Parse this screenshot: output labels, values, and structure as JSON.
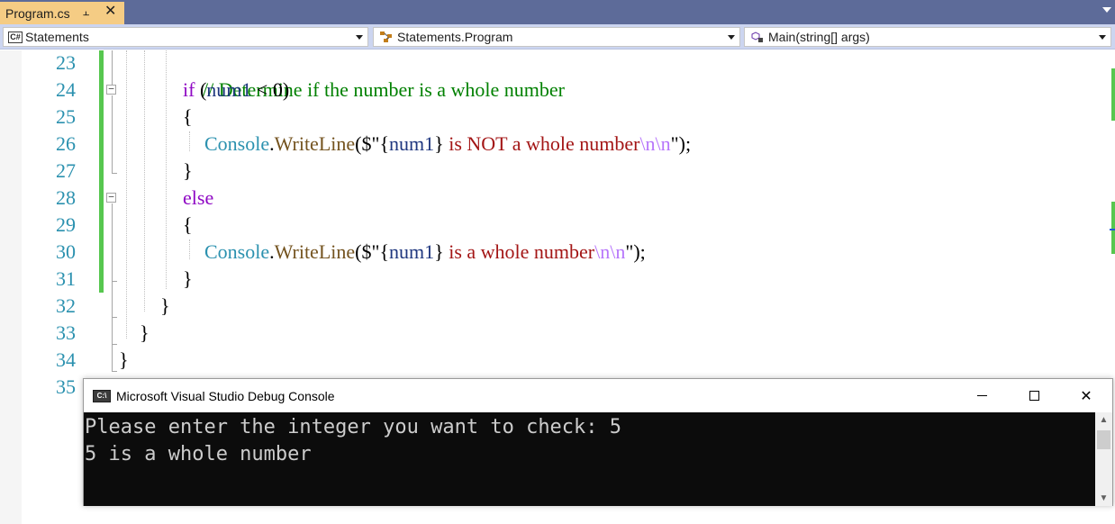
{
  "tab": {
    "label": "Program.cs",
    "pin_icon": "pin-icon",
    "close_icon": "close-icon"
  },
  "navbar": {
    "project": {
      "label": "Statements",
      "icon": "csharp-project-icon"
    },
    "type": {
      "label": "Statements.Program",
      "icon": "class-icon"
    },
    "member": {
      "label": "Main(string[] args)",
      "icon": "method-icon"
    }
  },
  "editor": {
    "line_numbers": [
      "23",
      "24",
      "25",
      "26",
      "27",
      "28",
      "29",
      "30",
      "31",
      "32",
      "33",
      "34",
      "35"
    ],
    "lines": {
      "l23": {
        "comment": "// Determine if the number is a whole number"
      },
      "l24": {
        "kw": "if",
        "rest_open": " (",
        "var": "num1",
        "rest": " < 0)"
      },
      "l25": {
        "text": "{"
      },
      "l26": {
        "cls": "Console",
        "dot": ".",
        "mth": "WriteLine",
        "open": "($\"",
        "brace_open": "{",
        "var": "num1",
        "brace_close": "}",
        "str": " is NOT a whole number",
        "esc": "\\n\\n",
        "close": "\");"
      },
      "l27": {
        "text": "}"
      },
      "l28": {
        "kw": "else"
      },
      "l29": {
        "text": "{"
      },
      "l30": {
        "cls": "Console",
        "dot": ".",
        "mth": "WriteLine",
        "open": "($\"",
        "brace_open": "{",
        "var": "num1",
        "brace_close": "}",
        "str": " is a whole number",
        "esc": "\\n\\n",
        "close": "\");"
      },
      "l31": {
        "text": "}"
      },
      "l32": {
        "text": "}"
      },
      "l33": {
        "text": "}"
      },
      "l34": {
        "text": "}"
      }
    }
  },
  "console": {
    "title": "Microsoft Visual Studio Debug Console",
    "icon_text": "C:\\",
    "lines": [
      "Please enter the integer you want to check: 5",
      "5 is a whole number"
    ],
    "minimize_label": "minimize",
    "maximize_label": "maximize",
    "close_glyph": "✕"
  },
  "colors": {
    "tab_active": "#f5cc84",
    "tabstrip": "#5d6b99",
    "navbar": "#ccd5f0",
    "line_number": "#2b91af",
    "change_bar": "#57c74f",
    "console_bg": "#0c0c0c"
  }
}
